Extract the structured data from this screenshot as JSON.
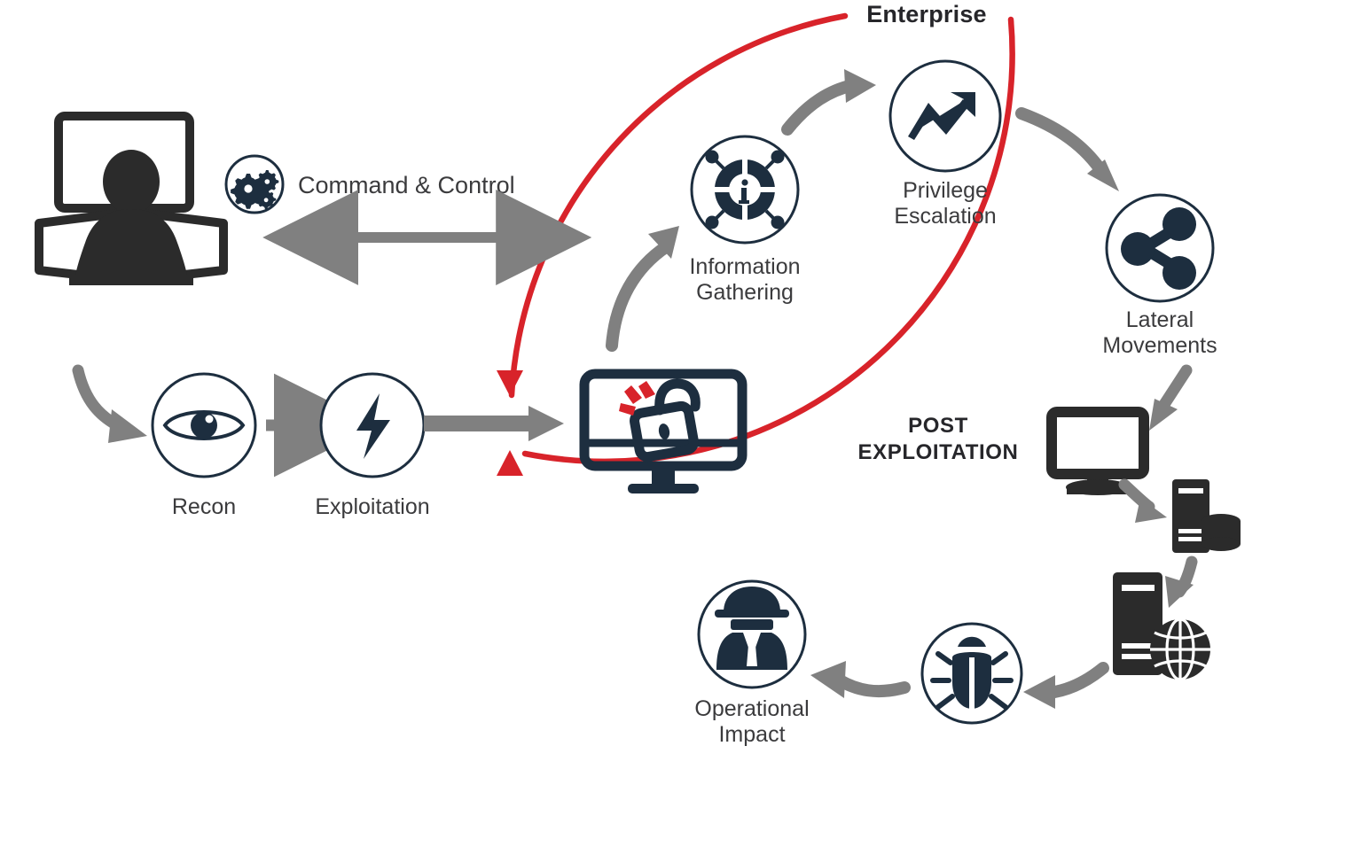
{
  "diagram": {
    "title_outer": "Enterprise",
    "title_inner": "POST EXPLOITATION",
    "title_inner_line1": "POST",
    "title_inner_line2": "EXPLOITATION",
    "colors": {
      "enterprise_boundary_red": "#d8232a",
      "arrow_gray": "#808080",
      "icon_navy": "#1d2e3f",
      "icon_black": "#2b2b2b",
      "label_gray": "#3b3b3d",
      "background": "#ffffff",
      "alert_red": "#d8232a"
    }
  },
  "external": {
    "attacker": {
      "label": "",
      "icon": "hacker-at-multi-monitor-workstation-icon"
    },
    "channel": {
      "label": "Command & Control",
      "badge_icon": "gears-icon",
      "arrow": "bidirectional-arrow"
    },
    "stages": [
      {
        "id": "recon",
        "label": "Recon",
        "icon": "eye-icon"
      },
      {
        "id": "exploitation",
        "label": "Exploitation",
        "icon": "lightning-bolt-icon"
      }
    ],
    "entry_arrow": "curved-arrow-into-recon",
    "link_arrow": "arrow-recon-to-exploitation",
    "breach_arrow": "arrow-exploitation-to-compromised-host"
  },
  "enterprise": {
    "compromised_host": {
      "icon": "monitor-with-broken-padlock-icon",
      "label": ""
    },
    "cycle": [
      {
        "id": "information-gathering",
        "label": "Information Gathering",
        "line1": "Information",
        "line2": "Gathering",
        "icon": "info-target-network-icon"
      },
      {
        "id": "privilege-escalation",
        "label": "Privilege Escalation",
        "line1": "Privilege",
        "line2": "Escalation",
        "icon": "rising-trend-arrow-icon"
      },
      {
        "id": "lateral-movements",
        "label": "Lateral Movements",
        "line1": "Lateral",
        "line2": "Movements",
        "icon": "share-nodes-icon"
      },
      {
        "id": "operational-impact",
        "label": "Operational Impact",
        "line1": "Operational",
        "line2": "Impact",
        "icon": "spy-agent-icon"
      }
    ],
    "post_exploitation_assets": [
      {
        "id": "workstation",
        "label": "",
        "icon": "desktop-monitor-icon"
      },
      {
        "id": "database-server",
        "label": "",
        "icon": "server-with-database-icon"
      },
      {
        "id": "web-server",
        "label": "",
        "icon": "server-with-globe-icon"
      },
      {
        "id": "malware",
        "label": "",
        "icon": "bug-icon"
      }
    ]
  }
}
